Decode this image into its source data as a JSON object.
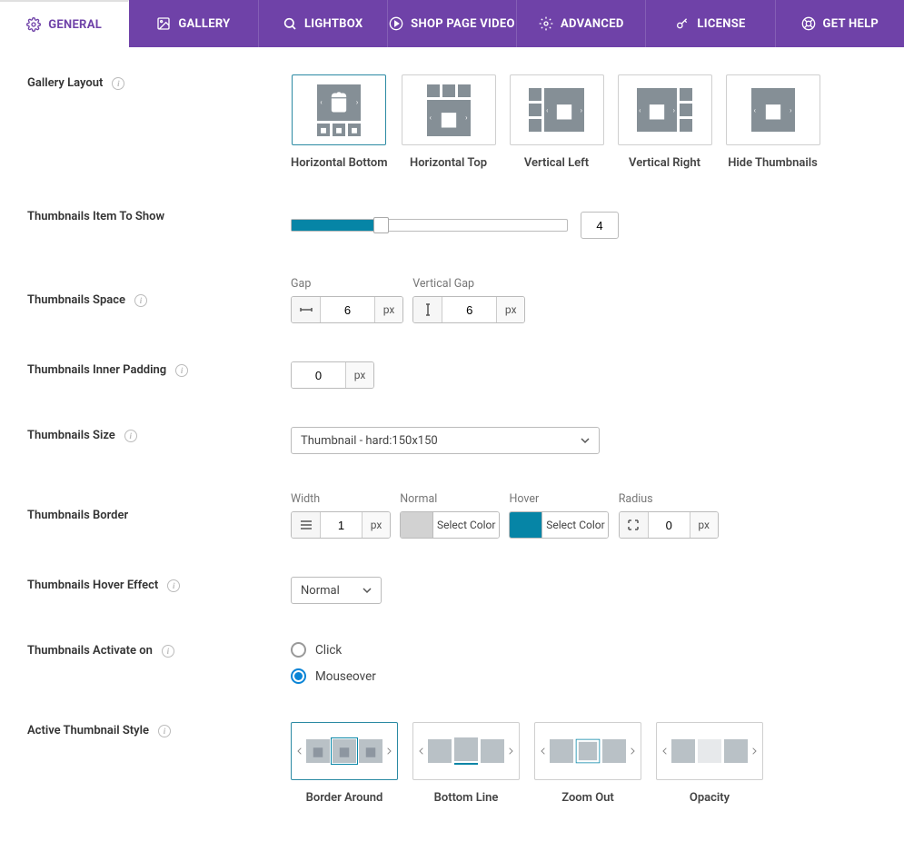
{
  "tabs": [
    {
      "label": "GENERAL",
      "icon": "gear"
    },
    {
      "label": "GALLERY",
      "icon": "image"
    },
    {
      "label": "LIGHTBOX",
      "icon": "search"
    },
    {
      "label": "SHOP PAGE VIDEO",
      "icon": "play"
    },
    {
      "label": "ADVANCED",
      "icon": "gear"
    },
    {
      "label": "LICENSE",
      "icon": "key"
    },
    {
      "label": "GET HELP",
      "icon": "help"
    }
  ],
  "fields": {
    "gallery_layout": {
      "label": "Gallery Layout"
    },
    "thumbs_to_show": {
      "label": "Thumbnails Item To Show",
      "value": "4"
    },
    "thumbs_space": {
      "label": "Thumbnails Space",
      "gap_label": "Gap",
      "gap": "6",
      "vgap_label": "Vertical Gap",
      "vgap": "6",
      "unit": "px"
    },
    "inner_padding": {
      "label": "Thumbnails Inner Padding",
      "value": "0",
      "unit": "px"
    },
    "thumbs_size": {
      "label": "Thumbnails Size",
      "value": "Thumbnail - hard:150x150"
    },
    "thumbs_border": {
      "label": "Thumbnails Border",
      "width_label": "Width",
      "width": "1",
      "unit": "px",
      "normal_label": "Normal",
      "hover_label": "Hover",
      "select_color": "Select Color",
      "radius_label": "Radius",
      "radius": "0"
    },
    "hover_effect": {
      "label": "Thumbnails Hover Effect",
      "value": "Normal"
    },
    "activate_on": {
      "label": "Thumbnails Activate on",
      "options": [
        "Click",
        "Mouseover"
      ]
    },
    "active_style": {
      "label": "Active Thumbnail Style"
    }
  },
  "layout_options": [
    "Horizontal Bottom",
    "Horizontal Top",
    "Vertical Left",
    "Vertical Right",
    "Hide Thumbnails"
  ],
  "style_options": [
    "Border Around",
    "Bottom Line",
    "Zoom Out",
    "Opacity"
  ]
}
